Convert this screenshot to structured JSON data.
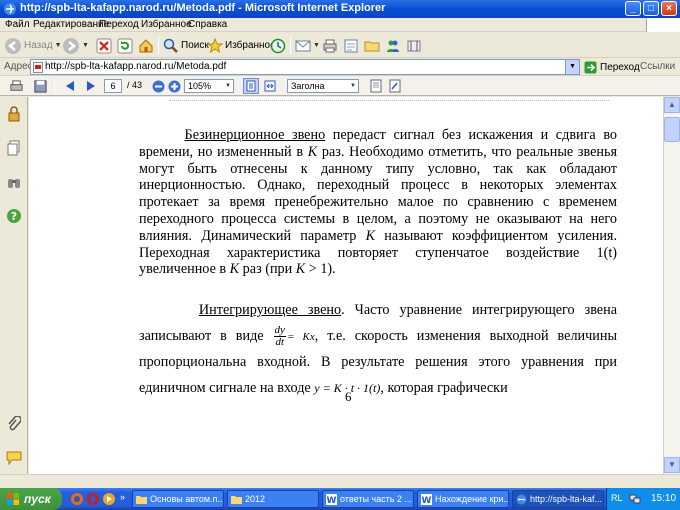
{
  "window": {
    "title": "http://spb-lta-kafapp.narod.ru/Metoda.pdf - Microsoft Internet Explorer"
  },
  "menu": {
    "items": [
      "Файл",
      "Редактирование",
      "Переход",
      "Избранное",
      "Справка"
    ]
  },
  "toolbar": {
    "back_label": "Назад",
    "search_label": "Поиск",
    "favorites_label": "Избранное"
  },
  "address": {
    "label": "Адрес",
    "url": "http://spb-lta-kafapp.narod.ru/Metoda.pdf",
    "go_label": "Переход",
    "links_label": "Ссылки"
  },
  "pdf_toolbar": {
    "current_page": "6",
    "page_count": "/ 43",
    "zoom": "105%",
    "style": "Заголна"
  },
  "document": {
    "p1_term": "Безинерционное звено",
    "p1_a": " передаст сигнал без искажения и сдвига во времени, но измененный в ",
    "p1_k1": "K",
    "p1_b": " раз. Необходимо отметить, что реальные звенья могут быть отнесены к данному типу условно, так как обладают инерционностью. Однако, переходный  процесс в некоторых элементах протекает за время пренебрежительно малое по сравнению с временем переходного процесса системы в целом, а поэтому не оказывают на него влияния. Динамический параметр ",
    "p1_k2": "K",
    "p1_c": " называют коэффициентом усиления. Переходная характеристика повторяет ступенчатое воздействие 1(t) увеличенное в ",
    "p1_k3": "K",
    "p1_d": " раз (при ",
    "p1_k4": "K",
    "p1_e": "  > 1).",
    "p2_term": "Интегрирующее звено",
    "p2_a": ". Часто уравнение интегрирующего звена записывают в виде ",
    "p2_frac_num": "dy",
    "p2_frac_den": "dt",
    "p2_eq_rhs": "= Kx",
    "p2_b": ", т.е. скорость изменения выходной величины пропорциональна входной. В результате решения этого уравнения при единичном сигнале на входе ",
    "p2_formula": "y = K · t · 1(t)",
    "p2_c": ", которая графически",
    "page_number": "6"
  },
  "taskbar": {
    "start_label": "пуск",
    "tasks": [
      "Основы автом.п...",
      "2012",
      "ответы часть 2 ...",
      "Нахождение кри...",
      "http://spb-lta-kaf..."
    ],
    "lang": "RL",
    "clock": "15:10"
  },
  "colors": {
    "titlebar": "#0a4fd3",
    "taskbar": "#245edb",
    "start_button": "#3b923a",
    "tray": "#0f8dea"
  }
}
